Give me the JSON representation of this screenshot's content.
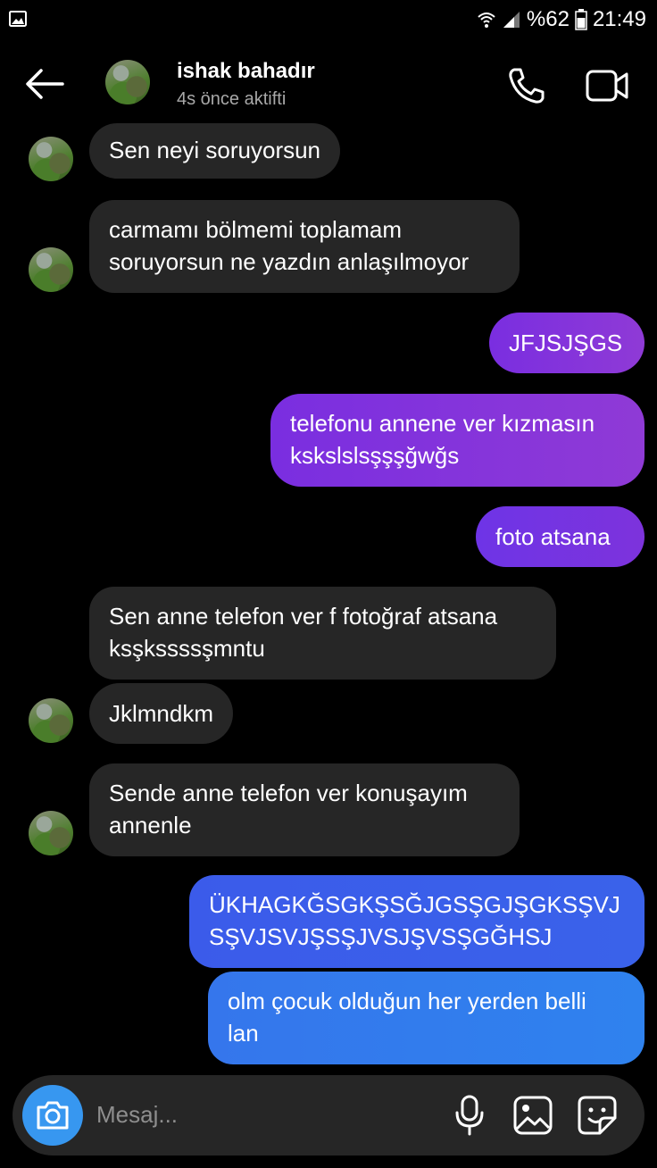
{
  "status_bar": {
    "battery": "%62",
    "time": "21:49"
  },
  "header": {
    "name": "ishak bahadır",
    "activity": "4s önce aktifti"
  },
  "messages": [
    {
      "from": "them",
      "lines": [
        "Sen neyi soruyorsun"
      ]
    },
    {
      "from": "them",
      "lines": [
        "carmamı bölmemi toplamam",
        "soruyorsun ne yazdın anlaşılmoyor"
      ]
    },
    {
      "from": "me",
      "lines": [
        "JFJSJŞGS"
      ]
    },
    {
      "from": "me",
      "lines": [
        "telefonu annene ver kızmasın",
        "kskslslsşşşğwğs"
      ]
    },
    {
      "from": "me",
      "lines": [
        "foto atsana"
      ]
    },
    {
      "from": "them",
      "lines": [
        "Sen anne telefon ver f fotoğraf atsana",
        "ksşkssssşmntu"
      ]
    },
    {
      "from": "them",
      "lines": [
        "Jklmndkm"
      ]
    },
    {
      "from": "them",
      "lines": [
        "Sende anne telefon ver konuşayım",
        "annenle"
      ]
    },
    {
      "from": "me",
      "lines": [
        "ÜKHAGKĞSGKŞSĞJGSŞGJŞGKSŞVJ",
        "SŞVJSVJŞSŞJVSJŞVSŞGĞHSJ"
      ]
    },
    {
      "from": "me",
      "lines": [
        "olm çocuk olduğun her yerden belli",
        "lan"
      ]
    }
  ],
  "composer": {
    "placeholder": "Mesaj..."
  },
  "icons": {
    "gallery_notification": "image-icon",
    "wifi": "wifi-icon",
    "signal": "signal-icon",
    "battery": "battery-icon",
    "back": "back-arrow-icon",
    "call": "phone-icon",
    "video": "video-call-icon",
    "camera": "camera-icon",
    "mic": "microphone-icon",
    "gallery": "gallery-icon",
    "sticker": "sticker-icon"
  },
  "colors": {
    "incoming_bubble": "#262626",
    "purple": "#7a2ee0",
    "blue": "#3b5bea",
    "camera_button": "#3797f0"
  }
}
